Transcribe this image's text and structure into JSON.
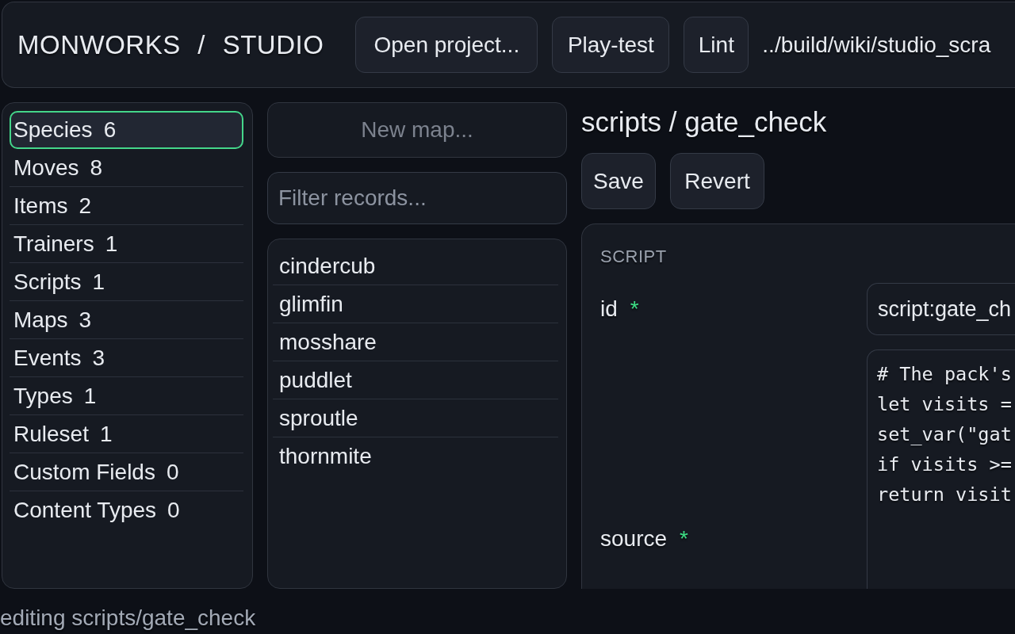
{
  "header": {
    "title": "MONWORKS / STUDIO",
    "buttons": [
      "Open project...",
      "Play-test",
      "Lint"
    ],
    "path": "../build/wiki/studio_scra"
  },
  "sidebar": {
    "items": [
      {
        "label": "Species",
        "count": "6",
        "selected": true
      },
      {
        "label": "Moves",
        "count": "8",
        "selected": false
      },
      {
        "label": "Items",
        "count": "2",
        "selected": false
      },
      {
        "label": "Trainers",
        "count": "1",
        "selected": false
      },
      {
        "label": "Scripts",
        "count": "1",
        "selected": false
      },
      {
        "label": "Maps",
        "count": "3",
        "selected": false
      },
      {
        "label": "Events",
        "count": "3",
        "selected": false
      },
      {
        "label": "Types",
        "count": "1",
        "selected": false
      },
      {
        "label": "Ruleset",
        "count": "1",
        "selected": false
      },
      {
        "label": "Custom Fields",
        "count": "0",
        "selected": false
      },
      {
        "label": "Content Types",
        "count": "0",
        "selected": false
      }
    ]
  },
  "records": {
    "new_button": {
      "label": "New map...",
      "disabled": true
    },
    "filter": {
      "placeholder": "Filter records..."
    },
    "items": [
      {
        "label": "cindercub",
        "selected": false
      },
      {
        "label": "glimfin",
        "selected": false
      },
      {
        "label": "mosshare",
        "selected": false
      },
      {
        "label": "puddlet",
        "selected": false
      },
      {
        "label": "sproutle",
        "selected": false
      },
      {
        "label": "thornmite",
        "selected": false
      }
    ]
  },
  "editor": {
    "title": "scripts / gate_check",
    "buttons": [
      "Save",
      "Revert"
    ],
    "section": {
      "heading": "SCRIPT",
      "fields": [
        {
          "kind": "text",
          "label": "id",
          "required_mark": "*",
          "value": "script:gate_ch"
        },
        {
          "kind": "code",
          "label": "source",
          "required_mark": "*",
          "lines": [
            "# The pack's",
            "let visits =",
            "set_var(\"gat",
            "if visits >=",
            "return visit"
          ]
        }
      ]
    }
  },
  "status_bar": {
    "text": "editing scripts/gate_check"
  }
}
